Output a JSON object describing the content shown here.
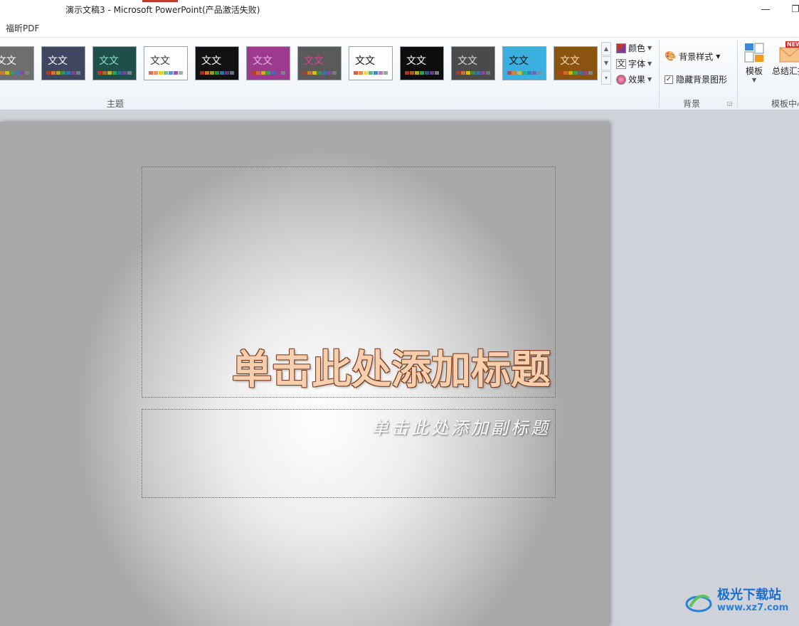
{
  "window": {
    "title": "演示文稿3  -  Microsoft PowerPoint(产品激活失败)",
    "minimize": "—",
    "maximize": "❐"
  },
  "menu": {
    "tabs": [
      "福昕PDF"
    ]
  },
  "ribbon": {
    "themes_group_label": "主题",
    "theme_sample_text": "文文",
    "theme_cmds": {
      "colors": "颜色",
      "fonts": "字体",
      "effects": "效果"
    },
    "background_group_label": "背景",
    "background_style": "背景样式",
    "hide_background_graphics": "隐藏背景图形",
    "hide_background_checked": true,
    "templates_group_label": "模板中心",
    "template_btn": "模板",
    "summary_btn": "总结汇报",
    "new_badge": "NEW",
    "themes": [
      {
        "bg": "#6e6e6e",
        "fg": "#ffffff"
      },
      {
        "bg": "#3e4660",
        "fg": "#ffffff"
      },
      {
        "bg": "#1f4f4a",
        "fg": "#8fe0c9"
      },
      {
        "bg": "#ffffff",
        "fg": "#333333"
      },
      {
        "bg": "#111111",
        "fg": "#ffffff"
      },
      {
        "bg": "#9c3a8e",
        "fg": "#f0b0e0"
      },
      {
        "bg": "#5a5a5a",
        "fg": "#e04090"
      },
      {
        "bg": "#ffffff",
        "fg": "#111111"
      },
      {
        "bg": "#0d0d0d",
        "fg": "#ffffff"
      },
      {
        "bg": "#4a4a4a",
        "fg": "#dddddd"
      },
      {
        "bg": "#3ab0e0",
        "fg": "#111111"
      },
      {
        "bg": "#8a5310",
        "fg": "#ffe0b0"
      }
    ]
  },
  "slide": {
    "title_placeholder": "单击此处添加标题",
    "subtitle_placeholder": "单击此处添加副标题"
  },
  "watermark": {
    "name": "极光下载站",
    "url": "www.xz7.com"
  }
}
